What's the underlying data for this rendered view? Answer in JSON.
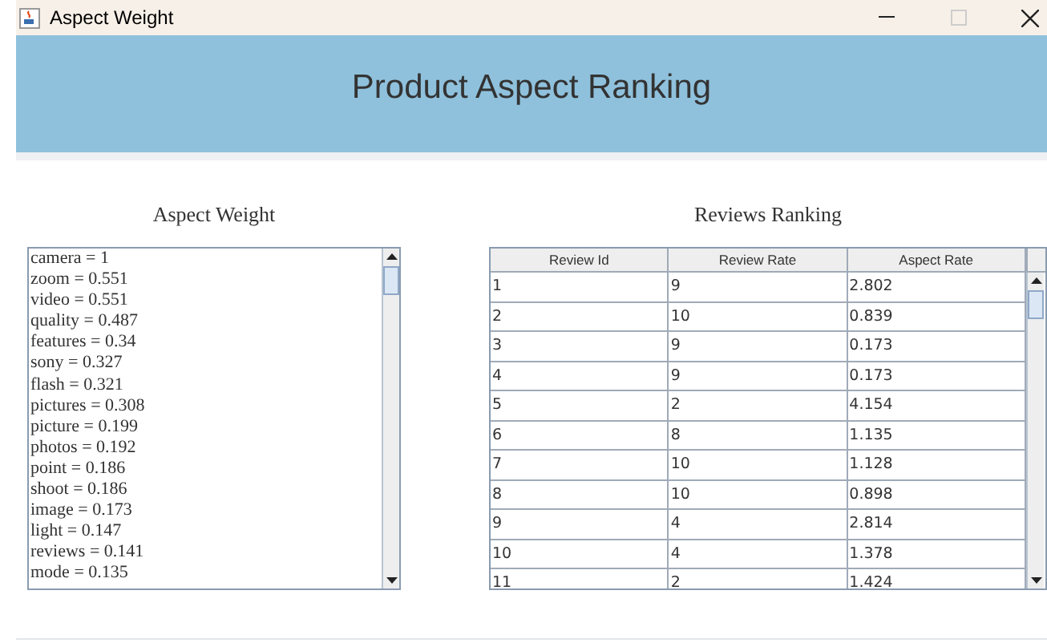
{
  "window": {
    "title": "Aspect Weight"
  },
  "header": {
    "title": "Product Aspect Ranking"
  },
  "aspect_weight": {
    "title": "Aspect Weight",
    "items": [
      "camera = 1",
      "zoom = 0.551",
      "video = 0.551",
      "quality = 0.487",
      "features = 0.34",
      "sony = 0.327",
      "flash = 0.321",
      "pictures = 0.308",
      "picture = 0.199",
      "photos = 0.192",
      "point = 0.186",
      "shoot = 0.186",
      "image = 0.173",
      "light = 0.147",
      "reviews = 0.141",
      "mode = 0.135"
    ]
  },
  "reviews_ranking": {
    "title": "Reviews Ranking",
    "columns": [
      "Review Id",
      "Review Rate",
      "Aspect Rate"
    ],
    "rows": [
      [
        "1",
        "9",
        "2.802"
      ],
      [
        "2",
        "10",
        "0.839"
      ],
      [
        "3",
        "9",
        "0.173"
      ],
      [
        "4",
        "9",
        "0.173"
      ],
      [
        "5",
        "2",
        "4.154"
      ],
      [
        "6",
        "8",
        "1.135"
      ],
      [
        "7",
        "10",
        "1.128"
      ],
      [
        "8",
        "10",
        "0.898"
      ],
      [
        "9",
        "4",
        "2.814"
      ],
      [
        "10",
        "4",
        "1.378"
      ],
      [
        "11",
        "2",
        "1.424"
      ]
    ]
  }
}
